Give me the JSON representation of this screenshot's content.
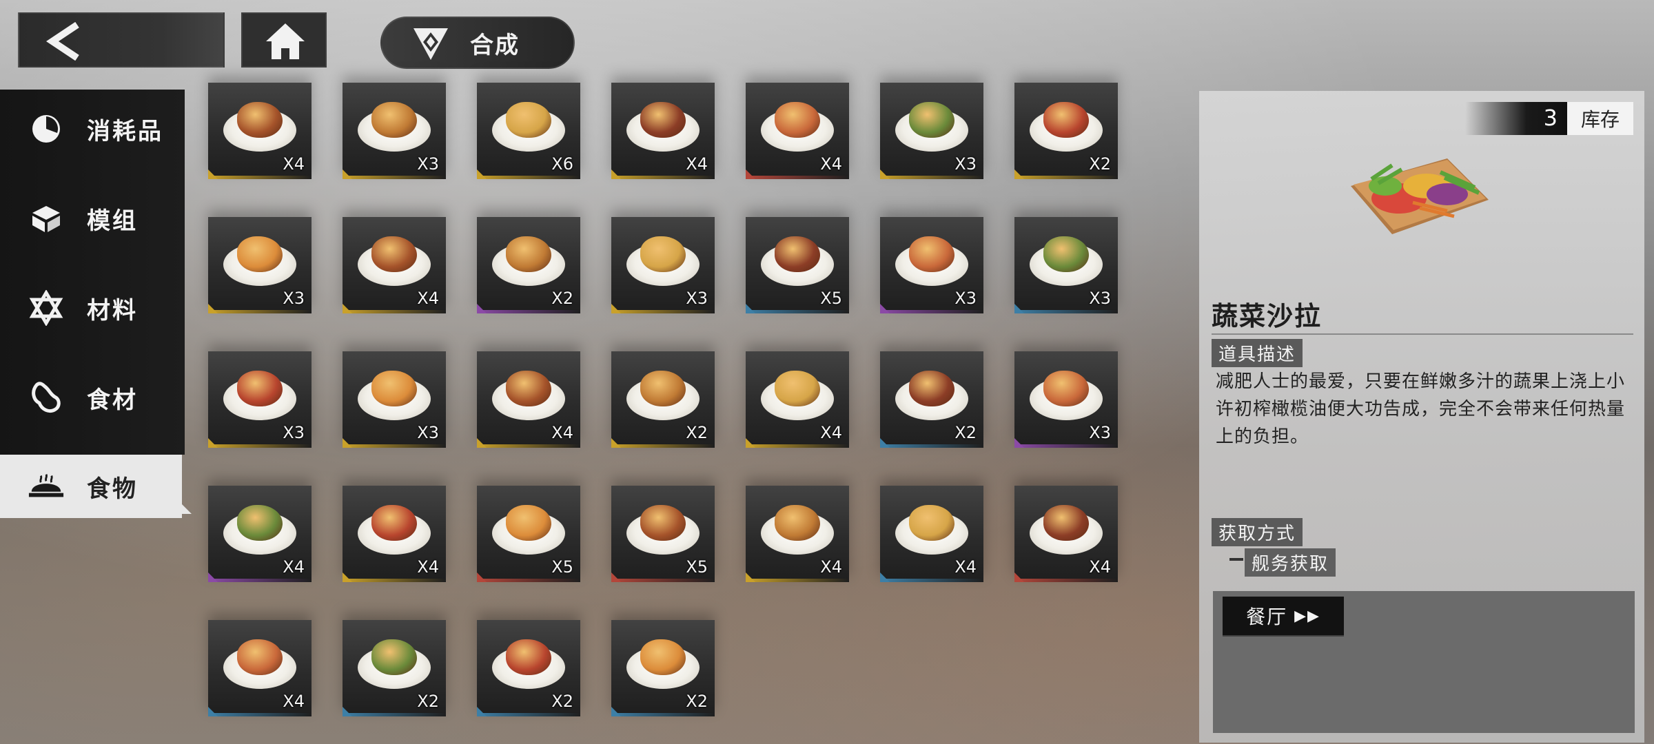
{
  "header": {
    "back_icon": "back-chevron-icon",
    "home_icon": "home-icon",
    "craft_icon": "triangle-emblem-icon",
    "craft_label": "合成"
  },
  "sidebar": {
    "items": [
      {
        "label": "消耗品",
        "icon": "pie-clock-icon"
      },
      {
        "label": "模组",
        "icon": "module-box-icon"
      },
      {
        "label": "材料",
        "icon": "hexagram-icon"
      },
      {
        "label": "食材",
        "icon": "ingredient-icon"
      },
      {
        "label": "食物",
        "icon": "food-dish-icon",
        "active": true
      }
    ]
  },
  "grid": {
    "items": [
      {
        "qty": "X4",
        "rarity": "yellow",
        "food": "ham-hock"
      },
      {
        "qty": "X3",
        "rarity": "yellow",
        "food": "burger"
      },
      {
        "qty": "X6",
        "rarity": "yellow",
        "food": "roast-chicken"
      },
      {
        "qty": "X4",
        "rarity": "yellow",
        "food": "sliced-steak"
      },
      {
        "qty": "X4",
        "rarity": "red",
        "food": "roast-duck"
      },
      {
        "qty": "X3",
        "rarity": "yellow",
        "food": "chicken-plate"
      },
      {
        "qty": "X2",
        "rarity": "yellow",
        "food": "mussels-wine"
      },
      {
        "qty": "X3",
        "rarity": "yellow",
        "food": "potato-wedges"
      },
      {
        "qty": "X4",
        "rarity": "yellow",
        "food": "seafood-pasta"
      },
      {
        "qty": "X2",
        "rarity": "purple",
        "food": "lobster-noodles"
      },
      {
        "qty": "X3",
        "rarity": "yellow",
        "food": "sauce-bottle"
      },
      {
        "qty": "X5",
        "rarity": "blue",
        "food": "dark-plate-dish"
      },
      {
        "qty": "X3",
        "rarity": "purple",
        "food": "hot-pot"
      },
      {
        "qty": "X3",
        "rarity": "blue",
        "food": "stew-bowl"
      },
      {
        "qty": "X3",
        "rarity": "yellow",
        "food": "takoyaki"
      },
      {
        "qty": "X3",
        "rarity": "yellow",
        "food": "crayfish-bowl"
      },
      {
        "qty": "X4",
        "rarity": "yellow",
        "food": "sushi-platter"
      },
      {
        "qty": "X2",
        "rarity": "yellow",
        "food": "eel-rice"
      },
      {
        "qty": "X4",
        "rarity": "yellow",
        "food": "wraps"
      },
      {
        "qty": "X2",
        "rarity": "blue",
        "food": "cake-slice"
      },
      {
        "qty": "X3",
        "rarity": "purple",
        "food": "fish-fillet"
      },
      {
        "qty": "X4",
        "rarity": "purple",
        "food": "baked-fish"
      },
      {
        "qty": "X4",
        "rarity": "yellow",
        "food": "grilled-fish"
      },
      {
        "qty": "X5",
        "rarity": "red",
        "food": "fancy-plate"
      },
      {
        "qty": "X5",
        "rarity": "red",
        "food": "dessert-plate"
      },
      {
        "qty": "X4",
        "rarity": "yellow",
        "food": "omelette-rice"
      },
      {
        "qty": "X4",
        "rarity": "blue",
        "food": "board-dish"
      },
      {
        "qty": "X4",
        "rarity": "red",
        "food": "escargot"
      },
      {
        "qty": "X4",
        "rarity": "blue",
        "food": "green-salad"
      },
      {
        "qty": "X2",
        "rarity": "blue",
        "food": "grilled-eel"
      },
      {
        "qty": "X2",
        "rarity": "blue",
        "food": "fried-fish"
      },
      {
        "qty": "X2",
        "rarity": "blue",
        "food": "skillet-dish"
      }
    ]
  },
  "detail": {
    "stock_count": "3",
    "stock_label": "库存",
    "item_name": "蔬菜沙拉",
    "desc_tag": "道具描述",
    "description": "减肥人士的最爱，只要在鲜嫩多汁的蔬果上浇上小许初榨橄榄油便大功告成，完全不会带来任何热量上的负担。",
    "source_tag": "获取方式",
    "source_sub": "舰务获取",
    "source_button": "餐厅",
    "source_button_icon": "double-arrow-icon"
  },
  "colors": {
    "yellow": "#c9a12a",
    "red": "#b4463a",
    "purple": "#8b4aa6",
    "blue": "#3d7fa6"
  }
}
